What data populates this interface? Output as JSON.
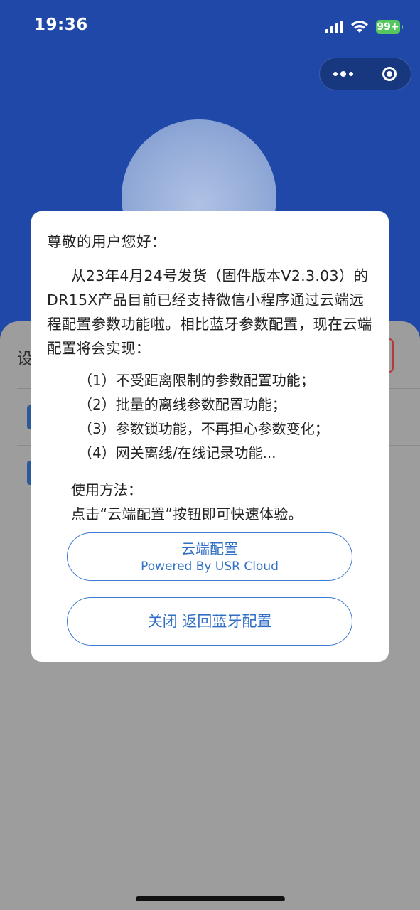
{
  "status_bar": {
    "time": "19:36",
    "battery": "99+"
  },
  "capsule": {
    "menu_icon": "more-dots-icon",
    "close_icon": "target-circle-icon"
  },
  "background": {
    "settings_label": "设"
  },
  "modal": {
    "greeting": "尊敬的用户您好：",
    "paragraph": "从23年4月24号发货（固件版本V2.3.03）的DR15X产品目前已经支持微信小程序通过云端远程配置参数功能啦。相比蓝牙参数配置，现在云端配置将会实现：",
    "features": [
      "（1）不受距离限制的参数配置功能；",
      "（2）批量的离线参数配置功能；",
      "（3）参数锁功能，不再担心参数变化；",
      "（4）网关离线/在线记录功能..."
    ],
    "usage_title": "使用方法：",
    "usage_desc": "点击“云端配置”按钮即可快速体验。",
    "cloud_button": {
      "label": "云端配置",
      "sublabel": "Powered By USR Cloud"
    },
    "close_button": {
      "label": "关闭 返回蓝牙配置"
    }
  },
  "colors": {
    "header_blue": "#1f48a8",
    "accent": "#2f6fc6",
    "battery_green": "#56c75e"
  }
}
